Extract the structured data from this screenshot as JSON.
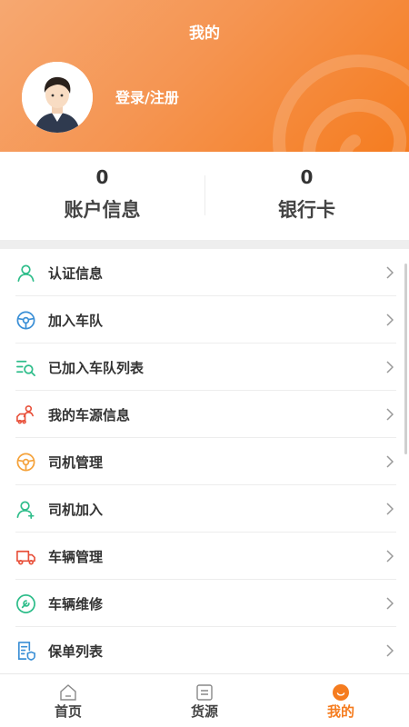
{
  "header": {
    "title": "我的",
    "login_label": "登录/注册"
  },
  "stats": [
    {
      "value": "0",
      "label": "账户信息"
    },
    {
      "value": "0",
      "label": "银行卡"
    }
  ],
  "menu": [
    {
      "label": "认证信息",
      "icon": "user-verify-icon"
    },
    {
      "label": "加入车队",
      "icon": "steering-wheel-icon"
    },
    {
      "label": "已加入车队列表",
      "icon": "list-search-icon"
    },
    {
      "label": "我的车源信息",
      "icon": "vehicle-info-icon"
    },
    {
      "label": "司机管理",
      "icon": "steering-wheel-icon"
    },
    {
      "label": "司机加入",
      "icon": "user-add-icon"
    },
    {
      "label": "车辆管理",
      "icon": "truck-icon"
    },
    {
      "label": "车辆维修",
      "icon": "wrench-icon"
    },
    {
      "label": "保单列表",
      "icon": "policy-list-icon"
    }
  ],
  "tabs": [
    {
      "label": "首页",
      "icon": "home-icon"
    },
    {
      "label": "货源",
      "icon": "cargo-icon"
    },
    {
      "label": "我的",
      "icon": "mine-icon",
      "active": true
    }
  ],
  "colors": {
    "accent": "#f57c1f",
    "green": "#2ebd8a",
    "blue": "#3a8fd6",
    "red": "#e8503a"
  }
}
